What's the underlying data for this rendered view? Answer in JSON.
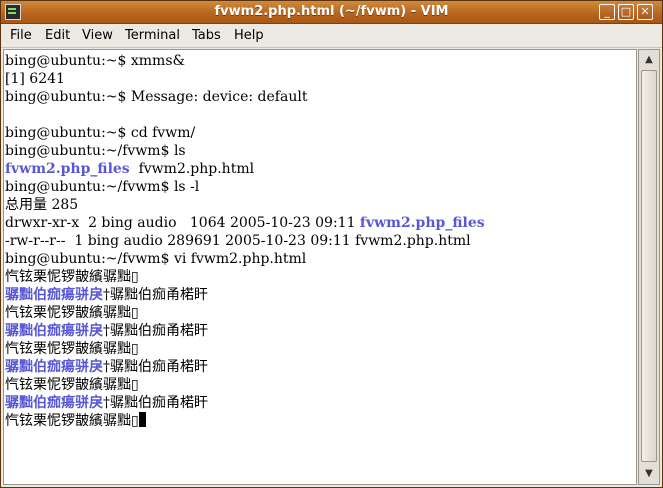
{
  "window": {
    "title": "fvwm2.php.html (~/fvwm) - VIM",
    "buttons": {
      "minimize": "_",
      "maximize": "□",
      "close": "✕"
    }
  },
  "menu": [
    {
      "label": "File"
    },
    {
      "label": "Edit"
    },
    {
      "label": "View"
    },
    {
      "label": "Terminal"
    },
    {
      "label": "Tabs"
    },
    {
      "label": "Help"
    }
  ],
  "terminal": {
    "lines": [
      {
        "text": "bing@ubuntu:~$ xmms&"
      },
      {
        "text": "[1] 6241"
      },
      {
        "text": "bing@ubuntu:~$ Message: device: default"
      },
      {
        "text": ""
      },
      {
        "text": "bing@ubuntu:~$ cd fvwm/"
      },
      {
        "text": "bing@ubuntu:~/fvwm$ ls"
      },
      {
        "dir": "fvwm2.php_files",
        "text": "  fvwm2.php.html"
      },
      {
        "text": "bing@ubuntu:~/fvwm$ ls -l"
      },
      {
        "text": "总用量 285"
      },
      {
        "text": "drwxr-xr-x  2 bing audio   1064 2005-10-23 09:11 ",
        "dir_after": "fvwm2.php_files"
      },
      {
        "text": "-rw-r--r--  1 bing audio 289691 2005-10-23 09:11 fvwm2.php.html"
      },
      {
        "text": "bing@ubuntu:~/fvwm$ vi fvwm2.php.html"
      },
      {
        "text": "忾铉栗怩锣皵繽骣黜▯"
      },
      {
        "dir": "骣黜伯痂瘍骈戾",
        "text": "†骣黜伯痂甬楉盰"
      },
      {
        "text": "忾铉栗怩锣皵繽骣黜▯"
      },
      {
        "dir": "骣黜伯痂瘍骈戾",
        "text": "†骣黜伯痂甬楉盰"
      },
      {
        "text": "忾铉栗怩锣皵繽骣黜▯"
      },
      {
        "dir": "骣黜伯痂瘍骈戾",
        "text": "†骣黜伯痂甬楉盰"
      },
      {
        "text": "忾铉栗怩锣皵繽骣黜▯"
      },
      {
        "dir": "骣黜伯痂瘍骈戾",
        "text": "†骣黜伯痂甬楉盰"
      },
      {
        "text": "忾铉栗怩锣皵繽骣黜▯",
        "cursor": true
      }
    ]
  },
  "scrollbar": {
    "up": "▲",
    "down": "▼"
  },
  "colors": {
    "directory": "#5858d6",
    "titlebar": "#b9661f"
  }
}
